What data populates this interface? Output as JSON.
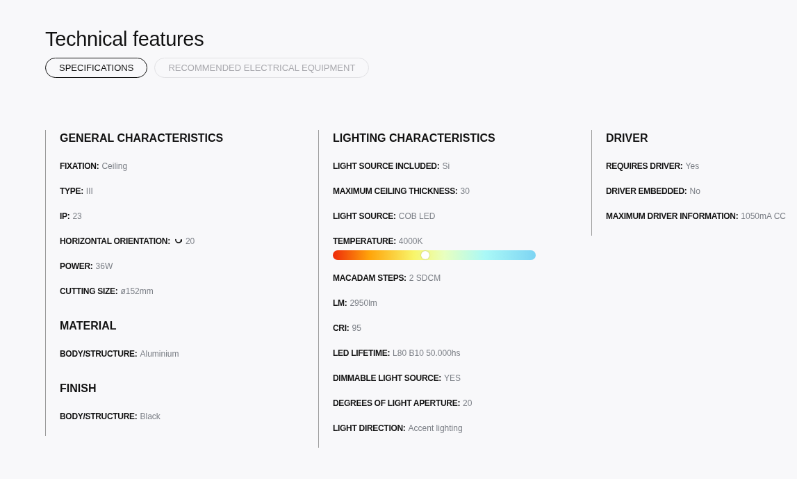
{
  "title": "Technical features",
  "tabs": [
    {
      "label": "SPECIFICATIONS",
      "selected": true
    },
    {
      "label": "RECOMMENDED ELECTRICAL EQUIPMENT",
      "selected": false
    }
  ],
  "columns": [
    {
      "sections": [
        {
          "title": "GENERAL CHARACTERISTICS",
          "rows": [
            {
              "kind": "text",
              "label": "FIXATION:",
              "value": "Ceiling"
            },
            {
              "kind": "text",
              "label": "TYPE:",
              "value": "III"
            },
            {
              "kind": "text",
              "label": "IP:",
              "value": "23"
            },
            {
              "kind": "rotation",
              "label": "HORIZONTAL ORIENTATION:",
              "value": "20"
            },
            {
              "kind": "text",
              "label": "POWER:",
              "value": "36W"
            },
            {
              "kind": "text",
              "label": "CUTTING SIZE:",
              "value": "ø152mm"
            }
          ]
        },
        {
          "title": "MATERIAL",
          "rows": [
            {
              "kind": "text",
              "label": "BODY/STRUCTURE:",
              "value": "Aluminium"
            }
          ]
        },
        {
          "title": "FINISH",
          "rows": [
            {
              "kind": "text",
              "label": "BODY/STRUCTURE:",
              "value": "Black"
            }
          ]
        }
      ]
    },
    {
      "sections": [
        {
          "title": "LIGHTING CHARACTERISTICS",
          "rows": [
            {
              "kind": "text",
              "label": "LIGHT SOURCE INCLUDED:",
              "value": "Si"
            },
            {
              "kind": "text",
              "label": "MAXIMUM CEILING THICKNESS:",
              "value": "30"
            },
            {
              "kind": "text",
              "label": "LIGHT SOURCE:",
              "value": "COB LED"
            },
            {
              "kind": "slider",
              "label": "TEMPERATURE:",
              "value": "4000K",
              "level": 0.455
            },
            {
              "kind": "text",
              "label": "MACADAM STEPS:",
              "value": "2 SDCM"
            },
            {
              "kind": "text",
              "label": "LM:",
              "value": "2950lm"
            },
            {
              "kind": "text",
              "label": "CRI:",
              "value": "95"
            },
            {
              "kind": "text",
              "label": "LED LIFETIME:",
              "value": "L80 B10 50.000hs"
            },
            {
              "kind": "text",
              "label": "DIMMABLE LIGHT SOURCE:",
              "value": "YES"
            },
            {
              "kind": "text",
              "label": "DEGREES OF LIGHT APERTURE:",
              "value": "20"
            },
            {
              "kind": "text",
              "label": "LIGHT DIRECTION:",
              "value": "Accent lighting"
            }
          ]
        }
      ]
    },
    {
      "sections": [
        {
          "title": "DRIVER",
          "rows": [
            {
              "kind": "text",
              "label": "REQUIRES DRIVER:",
              "value": "Yes"
            },
            {
              "kind": "text",
              "label": "DRIVER EMBEDDED:",
              "value": "No"
            },
            {
              "kind": "text",
              "label": "MAXIMUM DRIVER INFORMATION:",
              "value": "1050mA CC"
            }
          ]
        }
      ]
    }
  ]
}
